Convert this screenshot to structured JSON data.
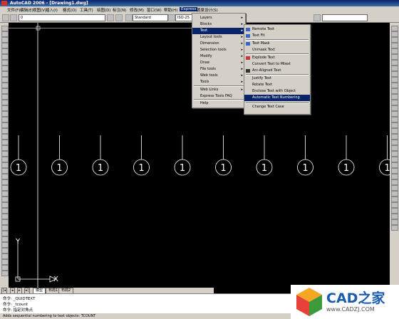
{
  "title": "AutoCAD 2006 - [Drawing1.dwg]",
  "menubar": [
    "文件(F)",
    "编辑(E)",
    "视图(V)",
    "插入(I)",
    "格式(O)",
    "工具(T)",
    "绘图(D)",
    "标注(N)",
    "修改(M)",
    "窗口(W)",
    "帮助(H)",
    "Express",
    "源泉设计(S)"
  ],
  "toolbar": {
    "layer_value": "0",
    "textstyle_value": "Standard",
    "dimstyle_value": "ISO-25"
  },
  "express_menu": [
    {
      "label": "Layers",
      "submenu": true
    },
    {
      "label": "Blocks",
      "submenu": true
    },
    {
      "label": "Text",
      "submenu": true,
      "active": true
    },
    {
      "label": "Layout tools",
      "submenu": true
    },
    {
      "label": "Dimension",
      "submenu": true
    },
    {
      "label": "Selection tools",
      "submenu": true
    },
    {
      "label": "Modify",
      "submenu": true
    },
    {
      "label": "Draw",
      "submenu": true
    },
    {
      "label": "File tools",
      "submenu": true
    },
    {
      "label": "Web tools",
      "submenu": true
    },
    {
      "label": "Tools",
      "submenu": true
    },
    {
      "label": "Web Links",
      "submenu": true
    },
    {
      "label": "Express Tools FAQ",
      "submenu": false
    },
    {
      "label": "Help",
      "submenu": false
    }
  ],
  "text_menu": [
    {
      "label": "Remote Text",
      "icon": "remote-text-icon"
    },
    {
      "label": "Text Fit",
      "icon": "text-fit-icon"
    },
    {
      "label": "Text Mask",
      "icon": "text-mask-icon"
    },
    {
      "label": "Unmask Text",
      "icon": ""
    },
    {
      "label": "Explode Text",
      "icon": "explode-text-icon"
    },
    {
      "label": "Convert Text to Mtext",
      "icon": ""
    },
    {
      "label": "Arc-Aligned Text",
      "icon": "arc-text-icon"
    },
    {
      "label": "Justify Text",
      "icon": ""
    },
    {
      "label": "Rotate Text",
      "icon": ""
    },
    {
      "label": "Enclose Text with Object",
      "icon": ""
    },
    {
      "label": "Automatic Text Numbering",
      "icon": "",
      "highlighted": true
    },
    {
      "label": "Change Text Case",
      "icon": ""
    }
  ],
  "drawing": {
    "circle_label": "1",
    "circle_count": 10,
    "ucs_y": "Y",
    "ucs_x": "X"
  },
  "tabs": [
    "模型",
    "布局1",
    "布局2"
  ],
  "command_lines": [
    "命令: _QUIDTEXT",
    "命令: _tcount",
    "命令:  指定对角点"
  ],
  "status_text": "Adds sequential numbering to text objects: TCOUNT",
  "logo": {
    "brand": "CAD之家",
    "url": "www.CADZJ.COM"
  },
  "colors": {
    "canvas": "#000000",
    "chrome": "#d4d0c8",
    "highlight": "#0a246a",
    "drawing": "#ffffff"
  }
}
